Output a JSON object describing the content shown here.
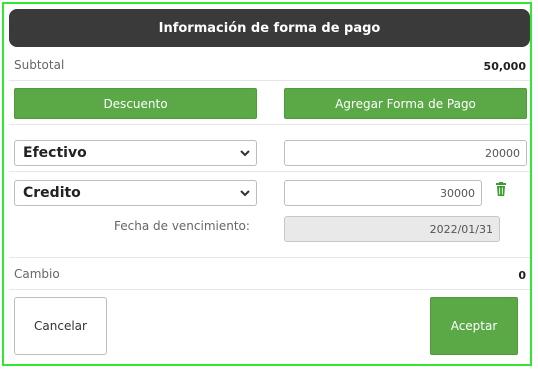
{
  "header": {
    "title": "Información de forma de pago"
  },
  "subtotal": {
    "label": "Subtotal",
    "value": "50,000"
  },
  "buttons": {
    "discount": "Descuento",
    "add_payment": "Agregar Forma de Pago",
    "cancel": "Cancelar",
    "accept": "Aceptar"
  },
  "payments": [
    {
      "method": "Efectivo",
      "amount": "20000"
    },
    {
      "method": "Credito",
      "amount": "30000",
      "due_label": "Fecha de vencimiento:",
      "due_date": "2022/01/31"
    }
  ],
  "change": {
    "label": "Cambio",
    "value": "0"
  },
  "colors": {
    "accent_green": "#5aa846",
    "header_dark": "#3a3a3a",
    "frame_green": "#33e633"
  },
  "icons": {
    "select_arrow": "chevron-down-icon",
    "delete": "trash-icon"
  }
}
